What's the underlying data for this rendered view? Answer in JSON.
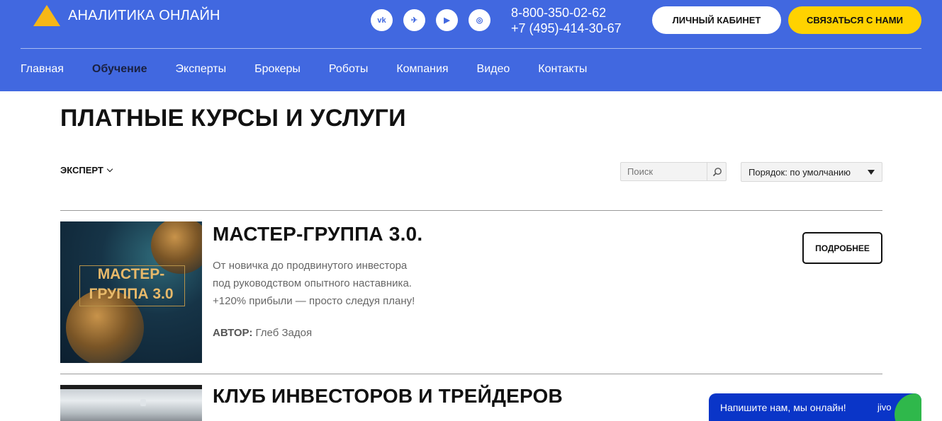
{
  "brand": {
    "name": "АНАЛИТИКА ОНЛАЙН",
    "accent": "#f6b716",
    "header_bg": "#4168e0"
  },
  "socials": [
    {
      "icon": "vk-icon",
      "glyph": "vk"
    },
    {
      "icon": "telegram-icon",
      "glyph": "✈"
    },
    {
      "icon": "youtube-icon",
      "glyph": "▶"
    },
    {
      "icon": "instagram-icon",
      "glyph": "◎"
    }
  ],
  "phones": [
    "8-800-350-02-62",
    "+7 (495)-414-30-67"
  ],
  "header": {
    "cabinet_label": "ЛИЧНЫЙ КАБИНЕТ",
    "contact_label": "СВЯЗАТЬСЯ С НАМИ"
  },
  "nav": [
    {
      "label": "Главная",
      "active": false
    },
    {
      "label": "Обучение",
      "active": true
    },
    {
      "label": "Эксперты",
      "active": false
    },
    {
      "label": "Брокеры",
      "active": false
    },
    {
      "label": "Роботы",
      "active": false
    },
    {
      "label": "Компания",
      "active": false
    },
    {
      "label": "Видео",
      "active": false
    },
    {
      "label": "Контакты",
      "active": false
    }
  ],
  "page": {
    "title": "ПЛАТНЫЕ КУРСЫ И УСЛУГИ"
  },
  "filters": {
    "expert_label": "ЭКСПЕРТ",
    "search_placeholder": "Поиск",
    "sort_label": "Порядок: по умолчанию"
  },
  "courses": [
    {
      "title": "МАСТЕР-ГРУППА 3.0.",
      "image_text": "МАСТЕР-\nГРУППА 3.0",
      "desc_lines": [
        "От новичка до продвинутого инвестора",
        "под руководством опытного наставника.",
        "+120% прибыли — просто следуя плану!"
      ],
      "author_label": "АВТОР:",
      "author_name": " Глеб Задоя",
      "more_label": "ПОДРОБНЕЕ"
    },
    {
      "title": "КЛУБ ИНВЕСТОРОВ И ТРЕЙДЕРОВ"
    }
  ],
  "chat": {
    "text": "Напишите нам, мы онлайн!",
    "brand": "jivo"
  }
}
